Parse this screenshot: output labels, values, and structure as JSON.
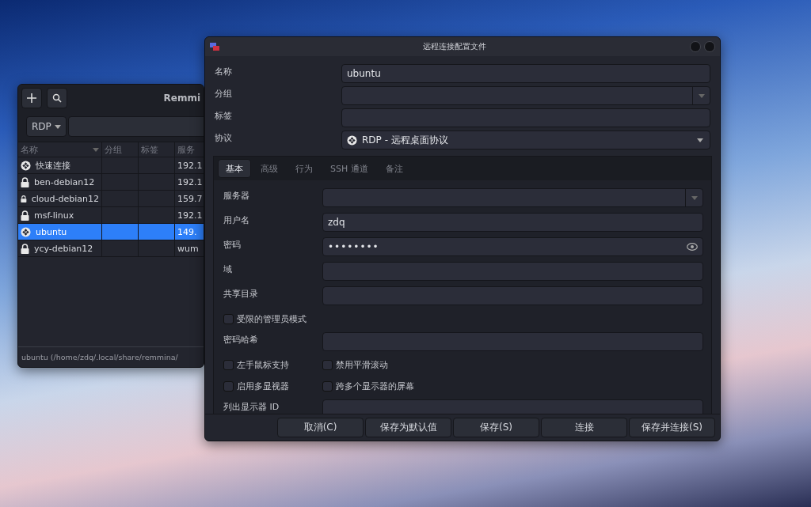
{
  "main_window": {
    "title": "Remmi",
    "filter": {
      "protocol": "RDP"
    },
    "columns": [
      "名称",
      "分组",
      "标签",
      "服务"
    ],
    "rows": [
      {
        "kind": "rdp",
        "name": "快速连接",
        "server": "192.1",
        "selected": false
      },
      {
        "kind": "ssh",
        "name": "ben-debian12",
        "server": "192.1",
        "selected": false
      },
      {
        "kind": "ssh",
        "name": "cloud-debian12",
        "server": "159.7",
        "selected": false
      },
      {
        "kind": "ssh",
        "name": "msf-linux",
        "server": "192.1",
        "selected": false
      },
      {
        "kind": "rdp",
        "name": "ubuntu",
        "server": "149.",
        "selected": true
      },
      {
        "kind": "ssh",
        "name": "ycy-debian12",
        "server": "wum",
        "selected": false
      }
    ],
    "status_bar": "ubuntu (/home/zdq/.local/share/remmina/"
  },
  "dialog": {
    "title": "远程连接配置文件",
    "profile": [
      {
        "kind": "text",
        "label": "名称",
        "value": "ubuntu"
      },
      {
        "kind": "combo",
        "label": "分组"
      },
      {
        "kind": "text",
        "label": "标签"
      },
      {
        "kind": "protocol",
        "label": "协议",
        "value": "RDP - 远程桌面协议"
      }
    ],
    "tabs": [
      {
        "label": "基本",
        "selected": true
      },
      {
        "label": "高级",
        "selected": false
      },
      {
        "label": "行为",
        "selected": false
      },
      {
        "label": "SSH 通道",
        "selected": false
      },
      {
        "label": "备注",
        "selected": false
      }
    ],
    "basic": [
      {
        "kind": "combo",
        "label": "服务器"
      },
      {
        "kind": "text",
        "label": "用户名",
        "value": "zdq"
      },
      {
        "kind": "password",
        "label": "密码",
        "value": "••••••••"
      },
      {
        "kind": "text",
        "label": "域"
      },
      {
        "kind": "text",
        "label": "共享目录"
      },
      {
        "kind": "checks",
        "checks": [
          {
            "label": "受限的管理员模式",
            "checked": false
          }
        ]
      },
      {
        "kind": "text",
        "label": "密码哈希"
      },
      {
        "kind": "checks",
        "checks": [
          {
            "label": "左手鼠标支持",
            "checked": false
          },
          {
            "label": "禁用平滑滚动",
            "checked": false
          }
        ]
      },
      {
        "kind": "checks",
        "checks": [
          {
            "label": "启用多显视器",
            "checked": false
          },
          {
            "label": "跨多个显示器的屏幕",
            "checked": false
          }
        ]
      },
      {
        "kind": "text",
        "label": "列出显示器 ID"
      }
    ],
    "buttons": [
      "取消(C)",
      "保存为默认值",
      "保存(S)",
      "连接",
      "保存并连接(S)"
    ]
  }
}
